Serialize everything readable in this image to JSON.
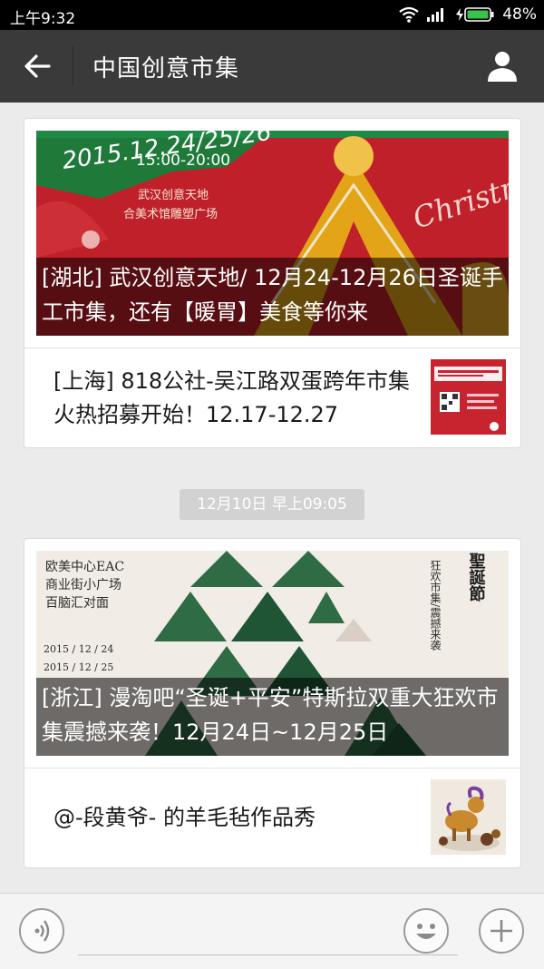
{
  "status_bar": {
    "time": "上午9:32",
    "battery": "48%"
  },
  "nav": {
    "title": "中国创意市集"
  },
  "card1": {
    "hero_title": "[湖北] 武汉创意天地/ 12月24-12月26日圣诞手工市集，还有【暖胃】美食等你来",
    "hero_art": {
      "date": "2015.12.24/25/26",
      "time": "15:00-20:00",
      "venue_line1": "武汉创意天地",
      "venue_line2": "合美术馆雕塑广场",
      "script": "Christmas"
    },
    "sub_title": "[上海] 818公社-吴江路双蛋跨年市集火热招募开始！12.17-12.27"
  },
  "timestamp": "12月10日 早上09:05",
  "card2": {
    "hero_title": "[浙江] 漫淘吧“圣诞+平安”特斯拉双重大狂欢市集震撼来袭！12月24日~12月25日",
    "hero_art": {
      "line1": "欧美中心EAC",
      "line2": "商业街小广场",
      "line3": "百脑汇对面",
      "date1": "2015 / 12 / 24",
      "date2": "2015 / 12 / 25",
      "vertical1": "狂欢市集/震撼来袭",
      "vertical2": "聖誕節"
    },
    "sub_title": "@-段黄爷- 的羊毛毡作品秀"
  },
  "icons": [
    "back-arrow-icon",
    "user-icon",
    "wifi-icon",
    "signal-icon",
    "battery-icon",
    "voice-icon",
    "emoji-icon",
    "plus-icon"
  ]
}
